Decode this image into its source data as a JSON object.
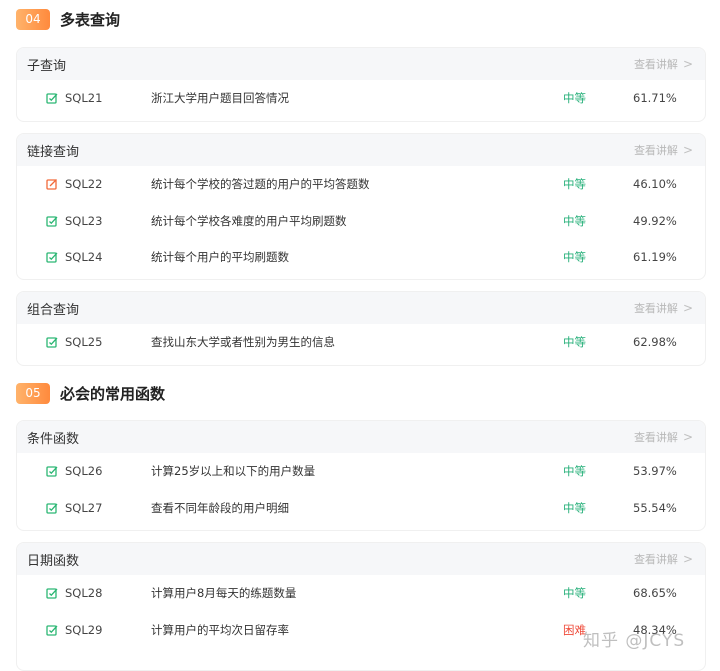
{
  "explain_label": "查看讲解",
  "sections": [
    {
      "num": "04",
      "title": "多表查询",
      "groups": [
        {
          "title": "子查询",
          "items": [
            {
              "id": "SQL21",
              "name": "浙江大学用户题目回答情况",
              "difficulty": "中等",
              "rate": "61.71%",
              "status": "green"
            }
          ]
        },
        {
          "title": "链接查询",
          "items": [
            {
              "id": "SQL22",
              "name": "统计每个学校的答过题的用户的平均答题数",
              "difficulty": "中等",
              "rate": "46.10%",
              "status": "orange"
            },
            {
              "id": "SQL23",
              "name": "统计每个学校各难度的用户平均刷题数",
              "difficulty": "中等",
              "rate": "49.92%",
              "status": "green"
            },
            {
              "id": "SQL24",
              "name": "统计每个用户的平均刷题数",
              "difficulty": "中等",
              "rate": "61.19%",
              "status": "green"
            }
          ]
        },
        {
          "title": "组合查询",
          "items": [
            {
              "id": "SQL25",
              "name": "查找山东大学或者性别为男生的信息",
              "difficulty": "中等",
              "rate": "62.98%",
              "status": "green"
            }
          ]
        }
      ]
    },
    {
      "num": "05",
      "title": "必会的常用函数",
      "groups": [
        {
          "title": "条件函数",
          "items": [
            {
              "id": "SQL26",
              "name": "计算25岁以上和以下的用户数量",
              "difficulty": "中等",
              "rate": "53.97%",
              "status": "green"
            },
            {
              "id": "SQL27",
              "name": "查看不同年龄段的用户明细",
              "difficulty": "中等",
              "rate": "55.54%",
              "status": "green"
            }
          ]
        },
        {
          "title": "日期函数",
          "items": [
            {
              "id": "SQL28",
              "name": "计算用户8月每天的练题数量",
              "difficulty": "中等",
              "rate": "68.65%",
              "status": "green"
            },
            {
              "id": "SQL29",
              "name": "计算用户的平均次日留存率",
              "difficulty": "困难",
              "rate": "48.34%",
              "status": "green"
            }
          ]
        }
      ]
    }
  ],
  "colors": {
    "medium": "#27b07a",
    "hard": "#ef4b3a",
    "done_icon": "#2bb673",
    "attempted_icon": "#f26a3a",
    "badge": "#ff8a3d"
  },
  "watermark": "知乎 @JCYS"
}
